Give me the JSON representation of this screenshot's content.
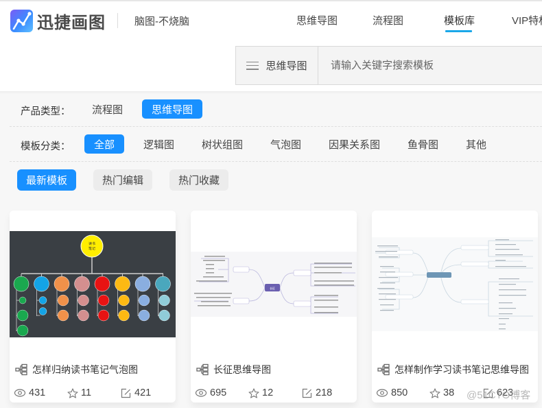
{
  "header": {
    "logo_text": "迅捷画图",
    "slogan": "脑图-不烧脑",
    "nav": [
      {
        "label": "思维导图",
        "active": false
      },
      {
        "label": "流程图",
        "active": false
      },
      {
        "label": "模板库",
        "active": true
      },
      {
        "label": "VIP特权",
        "active": false
      }
    ],
    "accent_color": "#1aa7e8"
  },
  "search": {
    "type_label": "思维导图",
    "placeholder": "请输入关键字搜索模板",
    "value": ""
  },
  "filters": {
    "product_type": {
      "label": "产品类型：",
      "options": [
        "流程图",
        "思维导图"
      ],
      "selected": "思维导图"
    },
    "category": {
      "label": "模板分类：",
      "options": [
        "全部",
        "逻辑图",
        "树状组图",
        "气泡图",
        "因果关系图",
        "鱼骨图",
        "其他"
      ],
      "selected": "全部"
    },
    "sort": {
      "options": [
        "最新模板",
        "热门编辑",
        "热门收藏"
      ],
      "selected": "最新模板"
    },
    "active_color": "#1890ff"
  },
  "cards": [
    {
      "title": "怎样归纳读书笔记气泡图",
      "views": "431",
      "favorites": "11",
      "edits": "421",
      "thumb_center_label": "读书笔记"
    },
    {
      "title": "长征思维导图",
      "views": "695",
      "favorites": "12",
      "edits": "218",
      "thumb_center_label": "长征"
    },
    {
      "title": "怎样制作学习读书笔记思维导图",
      "views": "850",
      "favorites": "38",
      "edits": "623",
      "thumb_center_label": ""
    }
  ],
  "watermark": "@51CTO博客"
}
